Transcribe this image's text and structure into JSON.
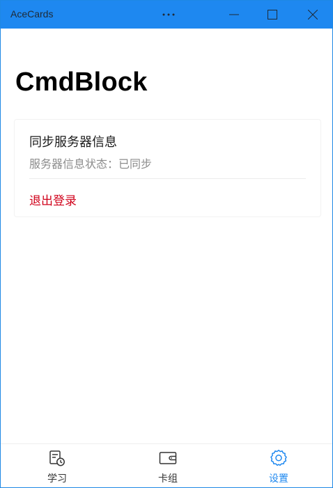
{
  "window": {
    "app_title": "AceCards"
  },
  "page": {
    "title": "CmdBlock"
  },
  "sync_card": {
    "title": "同步服务器信息",
    "status": "服务器信息状态：已同步",
    "logout_label": "退出登录"
  },
  "bottom_nav": {
    "items": [
      {
        "label": "学习",
        "icon": "study-icon",
        "active": false
      },
      {
        "label": "卡组",
        "icon": "wallet-icon",
        "active": false
      },
      {
        "label": "设置",
        "icon": "settings-icon",
        "active": true
      }
    ]
  },
  "colors": {
    "titlebar": "#1e88f0",
    "accent": "#1e88f0",
    "logout": "#d0021b",
    "muted_text": "#8c8c8c"
  }
}
